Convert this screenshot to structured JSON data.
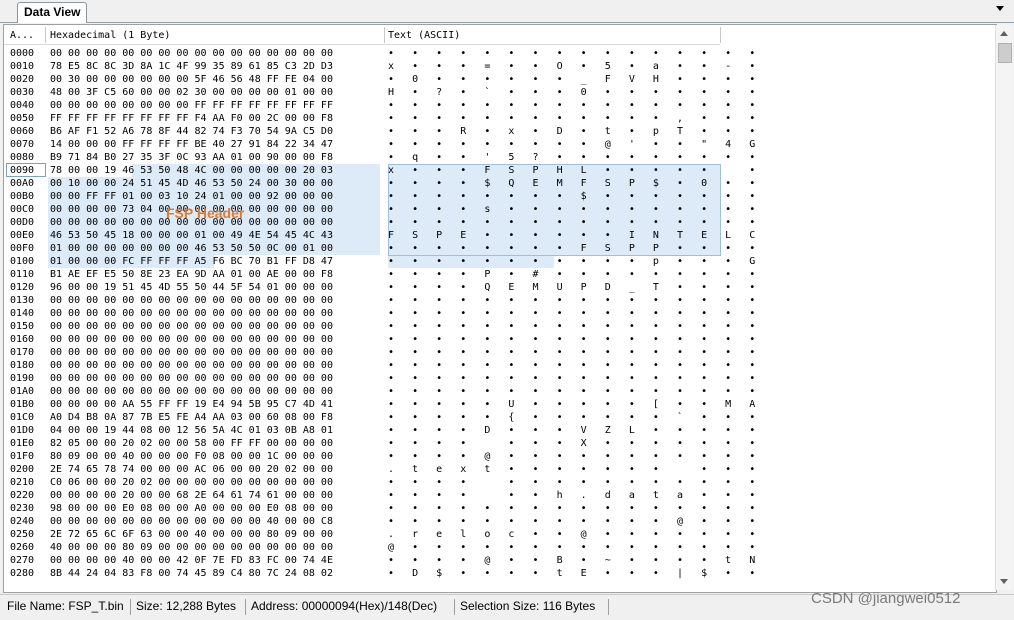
{
  "tab": {
    "title": "Data View"
  },
  "columns": {
    "addr": "A...",
    "hex": "Hexadecimal (1 Byte)",
    "text": "Text (ASCII)"
  },
  "annotation": "FSP Header",
  "rows": [
    {
      "addr": "0000",
      "hex": "00 00 00 00 00 00 00 00 00 00 00 00 00 00 00 00",
      "text": "•   •   •   •   •   •   •   •   •   •   •   •   •   •   •   •"
    },
    {
      "addr": "0010",
      "hex": "78 E5 8C 8C 3D 8A 1C 4F 99 35 89 61 85 C3 2D D3",
      "text": "x   •   •   •   =   •   •   O   •   5   •   a   •   •   -   •"
    },
    {
      "addr": "0020",
      "hex": "00 30 00 00 00 00 00 00 5F 46 56 48 FF FE 04 00",
      "text": "•   0   •   •   •   •   •   •   _   F   V   H   •   •   •   •"
    },
    {
      "addr": "0030",
      "hex": "48 00 3F C5 60 00 00 02 30 00 00 00 00 01 00 00",
      "text": "H   •   ?   •   `   •   •   •   0   •   •   •   •   •   •   •"
    },
    {
      "addr": "0040",
      "hex": "00 00 00 00 00 00 00 00 FF FF FF FF FF FF FF FF",
      "text": "•   •   •   •   •   •   •   •   •   •   •   •   •   •   •   •"
    },
    {
      "addr": "0050",
      "hex": "FF FF FF FF FF FF FF FF F4 AA F0 00 2C 00 00 F8",
      "text": "•   •   •   •   •   •   •   •   •   •   •   •   ,   •   •   •"
    },
    {
      "addr": "0060",
      "hex": "B6 AF F1 52 A6 78 8F 44 82 74 F3 70 54 9A C5 D0",
      "text": "•   •   •   R   •   x   •   D   •   t   •   p   T   •   •   •"
    },
    {
      "addr": "0070",
      "hex": "14 00 00 00 FF FF FF FF BE 40 27 91 84 22 34 47",
      "text": "•   •   •   •   •   •   •   •   •   @   '   •   •   \"   4   G"
    },
    {
      "addr": "0080",
      "hex": "B9 71 84 B0 27 35 3F 0C 93 AA 01 00 90 00 00 F8",
      "text": "•   q   •   •   '   5   ?   •   •   •   •   •   •   •   •   •"
    },
    {
      "addr": "0090",
      "hex": "78 00 00 19 46 53 50 48 4C 00 00 00 00 00 20 03",
      "text": "x   •   •   •   F   S   P   H   L   •   •   •   •   •       •"
    },
    {
      "addr": "00A0",
      "hex": "00 10 00 00 24 51 45 4D 46 53 50 24 00 30 00 00",
      "text": "•   •   •   •   $   Q   E   M   F   S   P   $   •   0   •   •"
    },
    {
      "addr": "00B0",
      "hex": "00 00 FF FF 01 00 03 10 24 01 00 00 92 00 00 00",
      "text": "•   •   •   •   •   •   •   •   $   •   •   •   •   •   •   •"
    },
    {
      "addr": "00C0",
      "hex": "00 00 00 00 73 04 00 00 00 00 00 00 00 00 00 00",
      "text": "•   •   •   •   s   •   •   •   •   •   •   •   •   •   •   •"
    },
    {
      "addr": "00D0",
      "hex": "00 00 00 00 00 00 00 00 00 00 00 00 00 00 00 00",
      "text": "•   •   •   •   •   •   •   •   •   •   •   •   •   •   •   •"
    },
    {
      "addr": "00E0",
      "hex": "46 53 50 45 18 00 00 00 01 00 49 4E 54 45 4C 43",
      "text": "F   S   P   E   •   •   •   •   •   •   I   N   T   E   L   C"
    },
    {
      "addr": "00F0",
      "hex": "01 00 00 00 00 00 00 00 46 53 50 50 0C 00 01 00",
      "text": "•   •   •   •   •   •   •   •   F   S   P   P   •   •   •   •"
    },
    {
      "addr": "0100",
      "hex": "01 00 00 00 FC FF FF FF A5 F6 BC 70 B1 FF D8 47",
      "text": "•   •   •   •   •   •   •   •   •   •   •   p   •   •   •   G"
    },
    {
      "addr": "0110",
      "hex": "B1 AE EF E5 50 8E 23 EA 9D AA 01 00 AE 00 00 F8",
      "text": "•   •   •   •   P   •   #   •   •   •   •   •   •   •   •   •"
    },
    {
      "addr": "0120",
      "hex": "96 00 00 19 51 45 4D 55 50 44 5F 54 01 00 00 00",
      "text": "•   •   •   •   Q   E   M   U   P   D   _   T   •   •   •   •"
    },
    {
      "addr": "0130",
      "hex": "00 00 00 00 00 00 00 00 00 00 00 00 00 00 00 00",
      "text": "•   •   •   •   •   •   •   •   •   •   •   •   •   •   •   •"
    },
    {
      "addr": "0140",
      "hex": "00 00 00 00 00 00 00 00 00 00 00 00 00 00 00 00",
      "text": "•   •   •   •   •   •   •   •   •   •   •   •   •   •   •   •"
    },
    {
      "addr": "0150",
      "hex": "00 00 00 00 00 00 00 00 00 00 00 00 00 00 00 00",
      "text": "•   •   •   •   •   •   •   •   •   •   •   •   •   •   •   •"
    },
    {
      "addr": "0160",
      "hex": "00 00 00 00 00 00 00 00 00 00 00 00 00 00 00 00",
      "text": "•   •   •   •   •   •   •   •   •   •   •   •   •   •   •   •"
    },
    {
      "addr": "0170",
      "hex": "00 00 00 00 00 00 00 00 00 00 00 00 00 00 00 00",
      "text": "•   •   •   •   •   •   •   •   •   •   •   •   •   •   •   •"
    },
    {
      "addr": "0180",
      "hex": "00 00 00 00 00 00 00 00 00 00 00 00 00 00 00 00",
      "text": "•   •   •   •   •   •   •   •   •   •   •   •   •   •   •   •"
    },
    {
      "addr": "0190",
      "hex": "00 00 00 00 00 00 00 00 00 00 00 00 00 00 00 00",
      "text": "•   •   •   •   •   •   •   •   •   •   •   •   •   •   •   •"
    },
    {
      "addr": "01A0",
      "hex": "00 00 00 00 00 00 00 00 00 00 00 00 00 00 00 00",
      "text": "•   •   •   •   •   •   •   •   •   •   •   •   •   •   •   •"
    },
    {
      "addr": "01B0",
      "hex": "00 00 00 00 AA 55 FF FF 19 E4 94 5B 95 C7 4D 41",
      "text": "•   •   •   •   •   U   •   •   •   •   •   [   •   •   M   A"
    },
    {
      "addr": "01C0",
      "hex": "A0 D4 B8 0A 87 7B E5 FE A4 AA 03 00 60 08 00 F8",
      "text": "•   •   •   •   •   {   •   •   •   •   •   •   `   •   •   •"
    },
    {
      "addr": "01D0",
      "hex": "04 00 00 19 44 08 00 12 56 5A 4C 01 03 0B A8 01",
      "text": "•   •   •   •   D   •   •   •   V   Z   L   •   •   •   •   •"
    },
    {
      "addr": "01E0",
      "hex": "82 05 00 00 20 02 00 00 58 00 FF FF 00 00 00 00",
      "text": "•   •   •   •       •   •   •   X   •   •   •   •   •   •   •"
    },
    {
      "addr": "01F0",
      "hex": "80 09 00 00 40 00 00 00 F0 08 00 00 1C 00 00 00",
      "text": "•   •   •   •   @   •   •   •   •   •   •   •   •   •   •   •"
    },
    {
      "addr": "0200",
      "hex": "2E 74 65 78 74 00 00 00 AC 06 00 00 20 02 00 00",
      "text": ".   t   e   x   t   •   •   •   •   •   •   •       •   •   •"
    },
    {
      "addr": "0210",
      "hex": "C0 06 00 00 20 02 00 00 00 00 00 00 00 00 00 00",
      "text": "•   •   •   •       •   •   •   •   •   •   •   •   •   •   •"
    },
    {
      "addr": "0220",
      "hex": "00 00 00 00 20 00 00 68 2E 64 61 74 61 00 00 00",
      "text": "•   •   •   •       •   •   h   .   d   a   t   a   •   •   •"
    },
    {
      "addr": "0230",
      "hex": "98 00 00 00 E0 08 00 00 A0 00 00 00 E0 08 00 00",
      "text": "•   •   •   •   •   •   •   •   •   •   •   •   •   •   •   •"
    },
    {
      "addr": "0240",
      "hex": "00 00 00 00 00 00 00 00 00 00 00 00 40 00 00 C8",
      "text": "•   •   •   •   •   •   •   •   •   •   •   •   @   •   •   •"
    },
    {
      "addr": "0250",
      "hex": "2E 72 65 6C 6F 63 00 00 40 00 00 00 80 09 00 00",
      "text": ".   r   e   l   o   c   •   •   @   •   •   •   •   •   •   •"
    },
    {
      "addr": "0260",
      "hex": "40 00 00 00 80 09 00 00 00 00 00 00 00 00 00 00",
      "text": "@   •   •   •   •   •   •   •   •   •   •   •   •   •   •   •"
    },
    {
      "addr": "0270",
      "hex": "00 00 00 00 40 00 00 42 0F 7E FD 83 FC 00 74 4E",
      "text": "•   •   •   •   @   •   •   B   •   ~   •   •   •   •   t   N"
    },
    {
      "addr": "0280",
      "hex": "8B 44 24 04 83 F8 00 74 45 89 C4 80 7C 24 08 02",
      "text": "•   D   $   •   •   •   •   t   E   •   •   •   |   $   •   •"
    }
  ],
  "status": {
    "file_name": "File Name: FSP_T.bin",
    "size": "Size: 12,288 Bytes",
    "address": "Address: 00000094(Hex)/148(Dec)",
    "selection": "Selection Size: 116 Bytes"
  },
  "watermark": "CSDN @jiangwei0512",
  "colors": {
    "selection": "#dcebf7",
    "annotation": "#e07a2e",
    "highlight_border": "#9ec0dc"
  }
}
